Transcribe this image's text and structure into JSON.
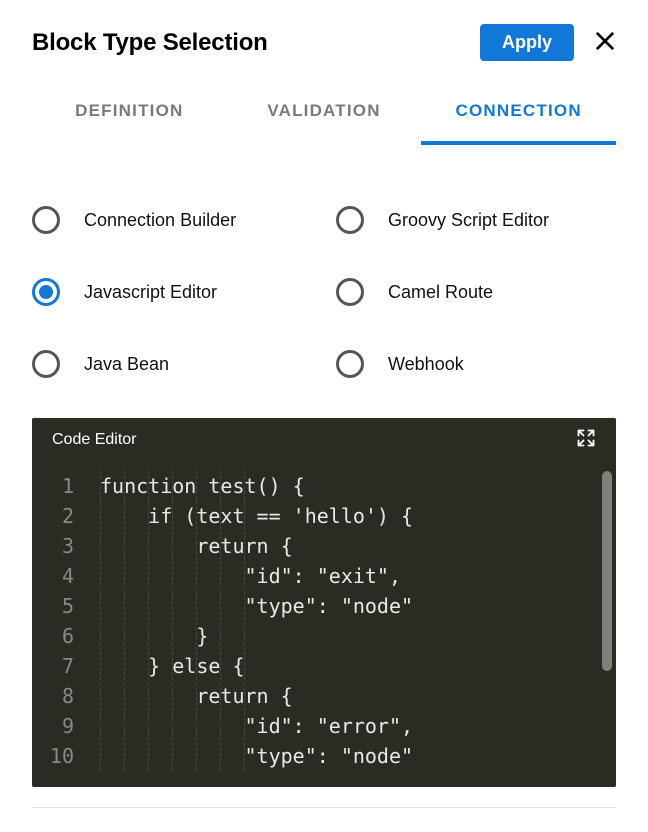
{
  "header": {
    "title": "Block Type Selection",
    "apply_label": "Apply"
  },
  "tabs": [
    {
      "label": "DEFINITION",
      "active": false
    },
    {
      "label": "VALIDATION",
      "active": false
    },
    {
      "label": "CONNECTION",
      "active": true
    }
  ],
  "options": [
    {
      "label": "Connection Builder",
      "selected": false
    },
    {
      "label": "Groovy Script Editor",
      "selected": false
    },
    {
      "label": "Javascript Editor",
      "selected": true
    },
    {
      "label": "Camel Route",
      "selected": false
    },
    {
      "label": "Java Bean",
      "selected": false
    },
    {
      "label": "Webhook",
      "selected": false
    }
  ],
  "editor": {
    "title": "Code Editor",
    "lines": [
      {
        "num": "1",
        "indent": 0,
        "text": "function test() {"
      },
      {
        "num": "2",
        "indent": 1,
        "text": "if (text == 'hello') {"
      },
      {
        "num": "3",
        "indent": 2,
        "text": "return {"
      },
      {
        "num": "4",
        "indent": 3,
        "text": "\"id\": \"exit\","
      },
      {
        "num": "5",
        "indent": 3,
        "text": "\"type\": \"node\""
      },
      {
        "num": "6",
        "indent": 2,
        "text": "}"
      },
      {
        "num": "7",
        "indent": 1,
        "text": "} else {"
      },
      {
        "num": "8",
        "indent": 2,
        "text": "return {"
      },
      {
        "num": "9",
        "indent": 3,
        "text": "\"id\": \"error\","
      },
      {
        "num": "10",
        "indent": 3,
        "text": "\"type\": \"node\""
      }
    ]
  }
}
